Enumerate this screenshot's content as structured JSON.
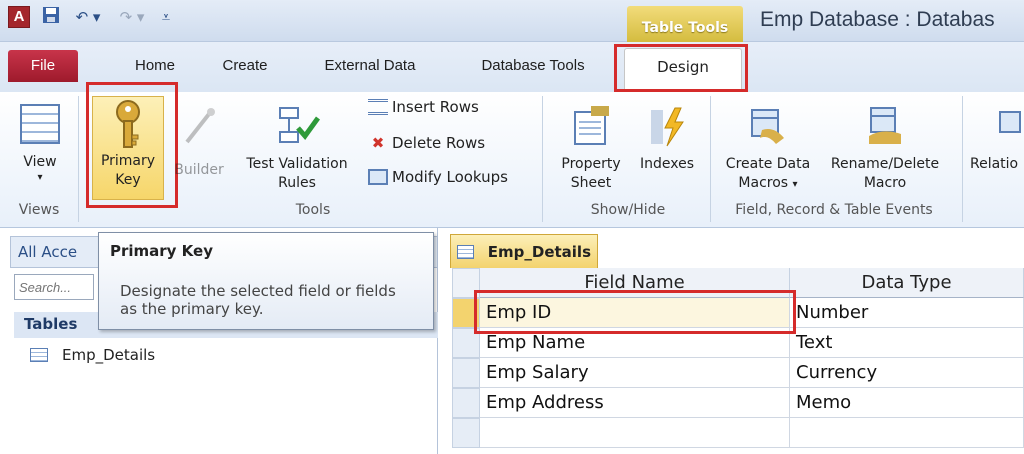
{
  "title_bar": {
    "app_icon_letter": "A",
    "contextual_tab_group": "Table Tools",
    "document_title": "Emp Database : Databas"
  },
  "tabs": {
    "file": "File",
    "home": "Home",
    "create": "Create",
    "external_data": "External Data",
    "database_tools": "Database Tools",
    "design": "Design"
  },
  "ribbon": {
    "views": {
      "group_label": "Views",
      "view_label": "View"
    },
    "tools": {
      "group_label": "Tools",
      "primary_key_line1": "Primary",
      "primary_key_line2": "Key",
      "builder_label": "Builder",
      "test_validation_line1": "Test Validation",
      "test_validation_line2": "Rules",
      "insert_rows": "Insert Rows",
      "delete_rows": "Delete Rows",
      "modify_lookups": "Modify Lookups"
    },
    "show_hide": {
      "group_label": "Show/Hide",
      "property_sheet_line1": "Property",
      "property_sheet_line2": "Sheet",
      "indexes": "Indexes"
    },
    "events": {
      "group_label": "Field, Record & Table Events",
      "create_data_macros_line1": "Create Data",
      "create_data_macros_line2": "Macros",
      "rename_delete_macro_line1": "Rename/Delete",
      "rename_delete_macro_line2": "Macro"
    },
    "relationships_partial": "Relatio"
  },
  "nav_pane": {
    "title": "All Acce",
    "search_placeholder": "Search...",
    "tables_header": "Tables",
    "items": [
      "Emp_Details"
    ]
  },
  "tooltip": {
    "title": "Primary Key",
    "body": "Designate the selected field or fields as the primary key."
  },
  "document": {
    "tab_label": "Emp_Details",
    "columns": [
      "Field Name",
      "Data Type"
    ],
    "rows": [
      {
        "field": "Emp ID",
        "type": "Number"
      },
      {
        "field": "Emp Name",
        "type": "Text"
      },
      {
        "field": "Emp Salary",
        "type": "Currency"
      },
      {
        "field": "Emp Address",
        "type": "Memo"
      }
    ]
  },
  "colors": {
    "highlight_red": "#d52b2b",
    "file_tab": "#b8283d",
    "table_tools_gold": "#e3c858",
    "ribbon_blue": "#dbe6f4"
  }
}
